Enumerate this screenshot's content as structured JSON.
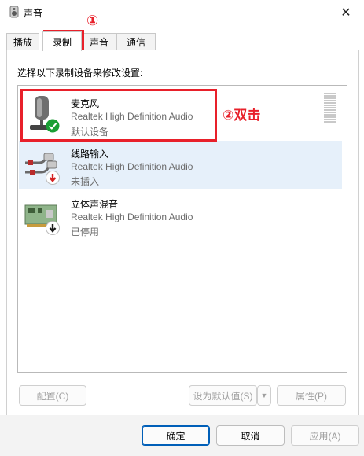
{
  "window": {
    "title": "声音"
  },
  "tabs": [
    {
      "label": "播放",
      "active": false
    },
    {
      "label": "录制",
      "active": true
    },
    {
      "label": "声音",
      "active": false
    },
    {
      "label": "通信",
      "active": false
    }
  ],
  "instruction": "选择以下录制设备来修改设置:",
  "devices": [
    {
      "name": "麦克风",
      "driver": "Realtek High Definition Audio",
      "status": "默认设备",
      "status_icon": "green-check-icon",
      "device_icon": "microphone-icon",
      "selected": false
    },
    {
      "name": "线路输入",
      "driver": "Realtek High Definition Audio",
      "status": "未插入",
      "status_icon": "red-down-arrow-icon",
      "device_icon": "line-in-cable-icon",
      "selected": true
    },
    {
      "name": "立体声混音",
      "driver": "Realtek High Definition Audio",
      "status": "已停用",
      "status_icon": "black-down-arrow-icon",
      "device_icon": "sound-card-icon",
      "selected": false
    }
  ],
  "annotations": {
    "step1": "①",
    "step2": "②双击"
  },
  "buttons": {
    "configure": "配置(C)",
    "set_default": "设为默认值(S)",
    "properties": "属性(P)",
    "ok": "确定",
    "cancel": "取消",
    "apply": "应用(A)"
  },
  "colors": {
    "annotation": "#e8202a",
    "selected_row": "#e6f0fa",
    "primary_border": "#005fb8"
  }
}
